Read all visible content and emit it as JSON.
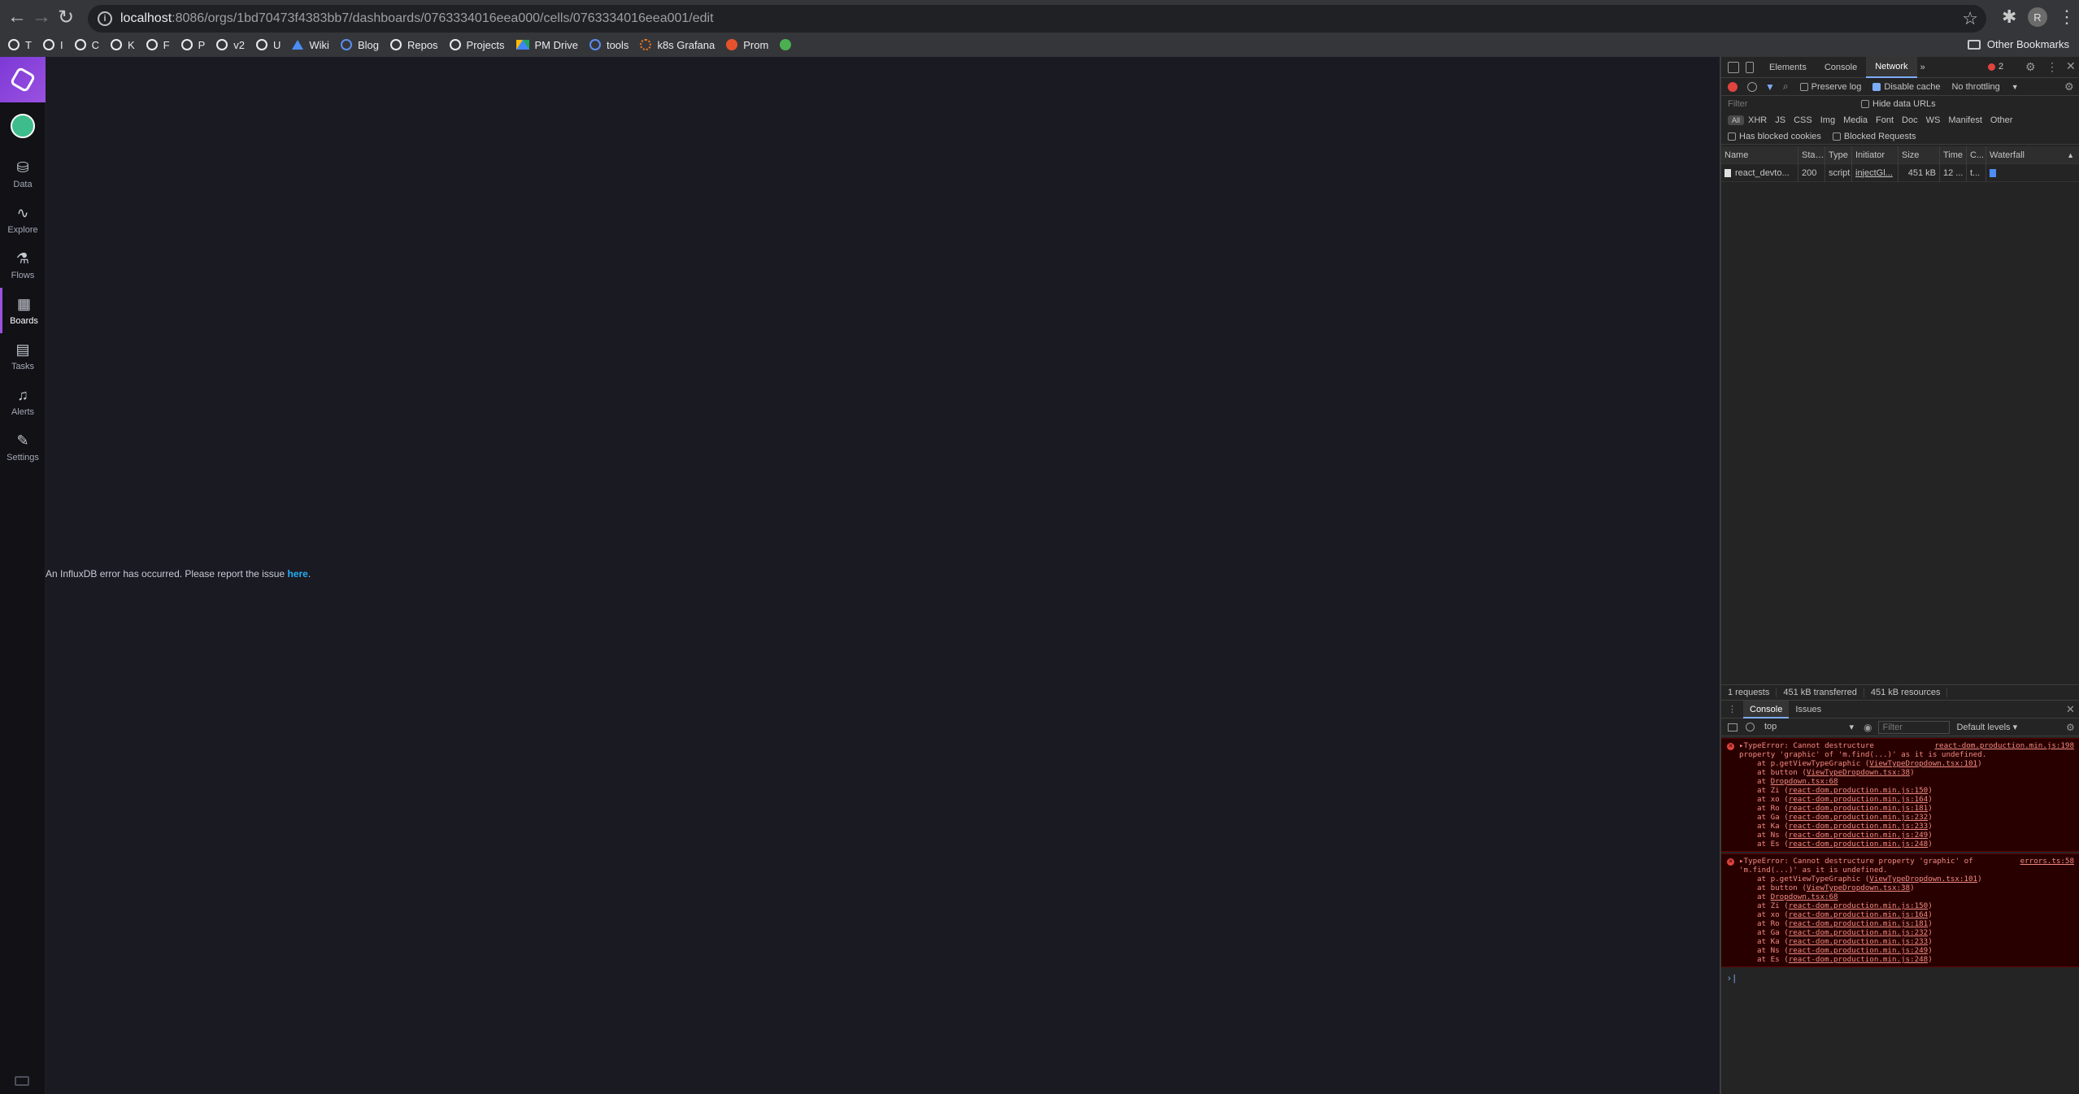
{
  "browser": {
    "url_host": "localhost",
    "url_rest": ":8086/orgs/1bd70473f4383bb7/dashboards/0763334016eea000/cells/0763334016eea001/edit",
    "profile_initial": "R",
    "bookmarks": [
      {
        "label": "T",
        "icon": "github-icon"
      },
      {
        "label": "I",
        "icon": "github-icon"
      },
      {
        "label": "C",
        "icon": "github-icon"
      },
      {
        "label": "K",
        "icon": "github-icon"
      },
      {
        "label": "F",
        "icon": "github-icon"
      },
      {
        "label": "P",
        "icon": "github-icon"
      },
      {
        "label": "v2",
        "icon": "github-icon"
      },
      {
        "label": "U",
        "icon": "github-icon"
      },
      {
        "label": "Wiki",
        "icon": "confluence-icon"
      },
      {
        "label": "Blog",
        "icon": "globe-icon"
      },
      {
        "label": "Repos",
        "icon": "github-icon"
      },
      {
        "label": "Projects",
        "icon": "github-icon"
      },
      {
        "label": "PM Drive",
        "icon": "drive-icon"
      },
      {
        "label": "tools",
        "icon": "globe-icon"
      },
      {
        "label": "k8s Grafana",
        "icon": "grafana-icon"
      },
      {
        "label": "Prom",
        "icon": "prometheus-icon"
      },
      {
        "label": "",
        "icon": "green-circle-icon"
      }
    ],
    "other_bookmarks": "Other Bookmarks"
  },
  "nav": {
    "items": [
      {
        "label": "Data",
        "icon": "database-icon"
      },
      {
        "label": "Explore",
        "icon": "graph-icon"
      },
      {
        "label": "Flows",
        "icon": "flask-icon"
      },
      {
        "label": "Boards",
        "icon": "dashboard-icon",
        "active": true
      },
      {
        "label": "Tasks",
        "icon": "calendar-icon"
      },
      {
        "label": "Alerts",
        "icon": "bell-icon"
      },
      {
        "label": "Settings",
        "icon": "wrench-icon"
      }
    ]
  },
  "main": {
    "error_text": "An InfluxDB error has occurred. Please report the issue ",
    "error_link": "here",
    "error_suffix": "."
  },
  "devtools": {
    "tabs": [
      "Elements",
      "Console",
      "Network"
    ],
    "active_tab": "Network",
    "more": "»",
    "error_count": "2",
    "network": {
      "preserve_log": "Preserve log",
      "disable_cache": "Disable cache",
      "throttling": "No throttling",
      "filter_placeholder": "Filter",
      "hide_data_urls": "Hide data URLs",
      "types": [
        "All",
        "XHR",
        "JS",
        "CSS",
        "Img",
        "Media",
        "Font",
        "Doc",
        "WS",
        "Manifest",
        "Other"
      ],
      "has_blocked_cookies": "Has blocked cookies",
      "blocked_requests": "Blocked Requests",
      "columns": [
        "Name",
        "Status",
        "Type",
        "Initiator",
        "Size",
        "Time",
        "C...",
        "Waterfall"
      ],
      "rows": [
        {
          "name": "react_devto...",
          "status": "200",
          "type": "script",
          "initiator": "injectGl...",
          "size": "451 kB",
          "time": "12 ...",
          "c": "t..."
        }
      ],
      "summary": [
        "1 requests",
        "451 kB transferred",
        "451 kB resources"
      ]
    },
    "drawer": {
      "tabs": [
        "Console",
        "Issues"
      ],
      "active_tab": "Console",
      "context": "top",
      "filter_placeholder": "Filter",
      "levels": "Default levels ▾",
      "errors": [
        {
          "head": "▸TypeError: Cannot destructure\nproperty 'graphic' of 'm.find(...)' as it is undefined.",
          "source": "react-dom.production.min.js:198",
          "stack": [
            {
              "fn": "at p.getViewTypeGraphic (",
              "loc": "ViewTypeDropdown.tsx:101",
              "end": ")"
            },
            {
              "fn": "at button (",
              "loc": "ViewTypeDropdown.tsx:38",
              "end": ")"
            },
            {
              "fn": "at ",
              "loc": "Dropdown.tsx:68",
              "end": ""
            },
            {
              "fn": "at Zi (",
              "loc": "react-dom.production.min.js:150",
              "end": ")"
            },
            {
              "fn": "at xo (",
              "loc": "react-dom.production.min.js:164",
              "end": ")"
            },
            {
              "fn": "at Ro (",
              "loc": "react-dom.production.min.js:181",
              "end": ")"
            },
            {
              "fn": "at Ga (",
              "loc": "react-dom.production.min.js:232",
              "end": ")"
            },
            {
              "fn": "at Ka (",
              "loc": "react-dom.production.min.js:233",
              "end": ")"
            },
            {
              "fn": "at Ns (",
              "loc": "react-dom.production.min.js:249",
              "end": ")"
            },
            {
              "fn": "at Es (",
              "loc": "react-dom.production.min.js:248",
              "end": ")"
            }
          ]
        },
        {
          "head": "▸TypeError: Cannot destructure property 'graphic' of\n'm.find(...)' as it is undefined.",
          "source": "errors.ts:58",
          "stack": [
            {
              "fn": "at p.getViewTypeGraphic (",
              "loc": "ViewTypeDropdown.tsx:101",
              "end": ")"
            },
            {
              "fn": "at button (",
              "loc": "ViewTypeDropdown.tsx:38",
              "end": ")"
            },
            {
              "fn": "at ",
              "loc": "Dropdown.tsx:68",
              "end": ""
            },
            {
              "fn": "at Zi (",
              "loc": "react-dom.production.min.js:150",
              "end": ")"
            },
            {
              "fn": "at xo (",
              "loc": "react-dom.production.min.js:164",
              "end": ")"
            },
            {
              "fn": "at Ro (",
              "loc": "react-dom.production.min.js:181",
              "end": ")"
            },
            {
              "fn": "at Ga (",
              "loc": "react-dom.production.min.js:232",
              "end": ")"
            },
            {
              "fn": "at Ka (",
              "loc": "react-dom.production.min.js:233",
              "end": ")"
            },
            {
              "fn": "at Ns (",
              "loc": "react-dom.production.min.js:249",
              "end": ")"
            },
            {
              "fn": "at Es (",
              "loc": "react-dom.production.min.js:248",
              "end": ")"
            }
          ]
        }
      ],
      "prompt": "›"
    }
  }
}
